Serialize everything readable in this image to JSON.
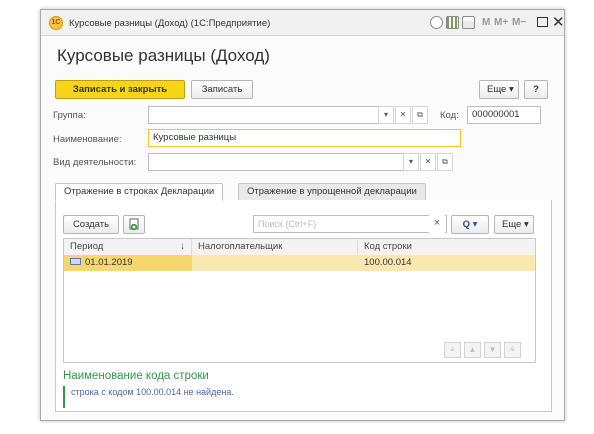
{
  "window": {
    "title": "Курсовые разницы (Доход) (1С:Предприятие)",
    "logo_text": "1С",
    "controls": {
      "m": "M",
      "m_plus": "M+",
      "m_minus": "M−",
      "close": "✕"
    }
  },
  "form": {
    "title": "Курсовые разницы (Доход)",
    "buttons": {
      "save_close": "Записать и закрыть",
      "save": "Записать",
      "more": "Еще ▾",
      "help": "?"
    }
  },
  "fields": {
    "group_label": "Группа:",
    "group_value": "",
    "code_label": "Код:",
    "code_value": "000000001",
    "name_label": "Наименование:",
    "name_value": "Курсовые разницы",
    "activity_label": "Вид деятельности:",
    "activity_value": ""
  },
  "tabs": [
    {
      "label": "Отражение в строках Декларации",
      "active": true
    },
    {
      "label": "Отражение в упрощенной декларации",
      "active": false
    }
  ],
  "toolbar": {
    "create": "Создать",
    "search_placeholder": "Поиск (Ctrl+F)",
    "clear": "×",
    "search_btn": "Q ▾",
    "more": "Еще ▾"
  },
  "table": {
    "columns": [
      "Период",
      "Налогоплательщик",
      "Код строки"
    ],
    "sort_marker": "↓",
    "rows": [
      {
        "period": "01.01.2019",
        "taxpayer": "",
        "code": "100.00.014"
      }
    ]
  },
  "info": {
    "title": "Наименование кода строки",
    "text": "строка с кодом 100.00.014 не найдена."
  },
  "colors": {
    "accent": "#f7d417",
    "selection": "#fbe7b0",
    "info_green": "#2e9a48",
    "info_text": "#4a66a8"
  }
}
